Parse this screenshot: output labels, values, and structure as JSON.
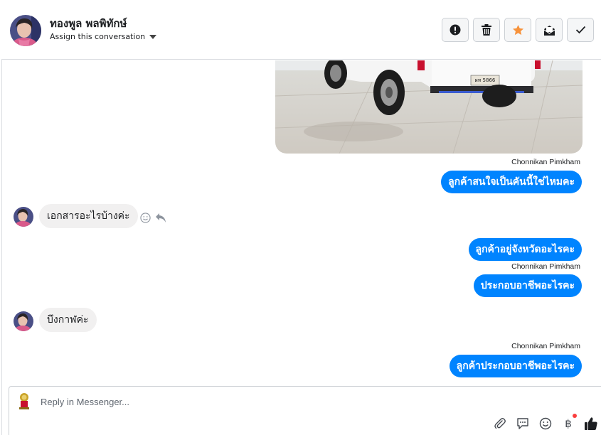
{
  "header": {
    "contact_name": "ทองพูล พลพิทักษ์",
    "assign_label": "Assign this conversation",
    "actions": [
      {
        "name": "spam-button",
        "icon": "exclamation-icon"
      },
      {
        "name": "delete-button",
        "icon": "trash-icon"
      },
      {
        "name": "star-button",
        "icon": "star-icon",
        "color": "#f7923b"
      },
      {
        "name": "mark-unread-button",
        "icon": "envelope-icon"
      },
      {
        "name": "mark-done-button",
        "icon": "check-icon"
      }
    ]
  },
  "thread": {
    "photo_plate_text": "ผท 5866",
    "messages": [
      {
        "direction": "out",
        "sender": "Chonnikan Pimkham",
        "text": "ลูกค้าสนใจเป็นคันนี้ใช่ไหมคะ"
      },
      {
        "direction": "in",
        "text": "เอกสารอะไรบ้างค่ะ"
      },
      {
        "direction": "out",
        "text": "ลูกค้าอยู่จังหวัดอะไรคะ"
      },
      {
        "direction": "out",
        "sender": "Chonnikan Pimkham",
        "text": "ประกอบอาชีพอะไรคะ"
      },
      {
        "direction": "in",
        "text": "บึงกาฬค่ะ"
      },
      {
        "direction": "out",
        "sender": "Chonnikan Pimkham",
        "text": "ลูกค้าประกอบอาชีพอะไรคะ"
      }
    ]
  },
  "composer": {
    "placeholder": "Reply in Messenger...",
    "accent": "#0084ff"
  }
}
